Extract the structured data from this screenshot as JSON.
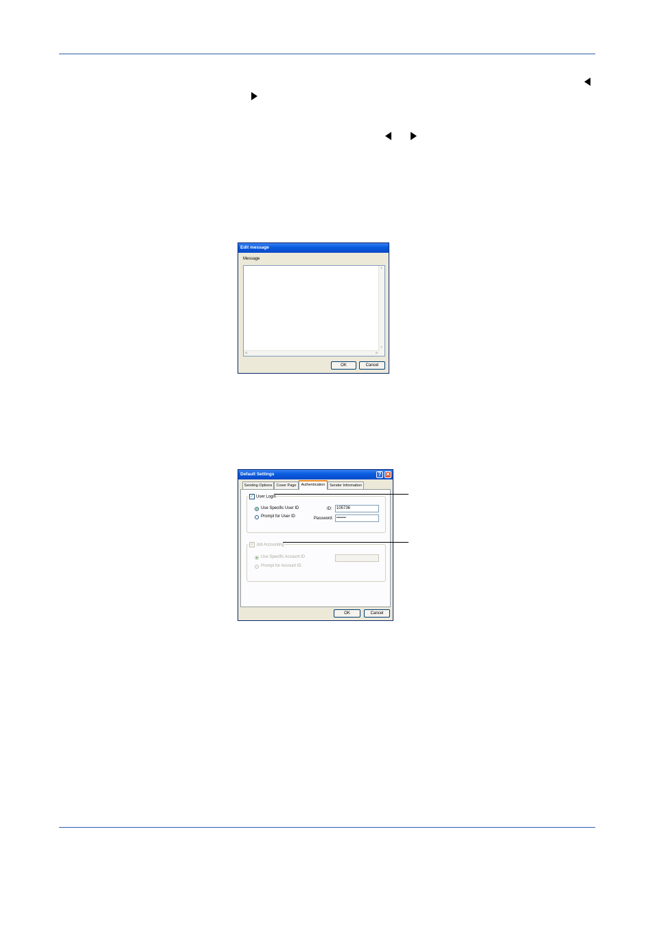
{
  "edit_message_dialog": {
    "title": "Edit message",
    "message_label": "Message",
    "ok_label": "OK",
    "cancel_label": "Cancel"
  },
  "default_settings_dialog": {
    "title": "Default Settings",
    "help_glyph": "?",
    "close_glyph": "✕",
    "tabs": [
      "Sending Options",
      "Cover Page",
      "Authentication",
      "Sender Information"
    ],
    "active_tab": "Authentication",
    "user_login": {
      "label": "User Login",
      "checked": true,
      "use_specific_label": "Use Specific User ID",
      "prompt_label": "Prompt for User ID",
      "id_label": "ID:",
      "id_value": "105736",
      "password_label": "Password:",
      "password_value": "••••••••"
    },
    "job_accounting": {
      "label": "Job Accounting",
      "checked": true,
      "enabled": false,
      "use_specific_label": "Use Specific Account ID",
      "prompt_label": "Prompt for Account ID"
    },
    "ok_label": "OK",
    "cancel_label": "Cancel"
  },
  "colors": {
    "rule": "#2a5db0",
    "xp_title": "#0a5ee0",
    "dialog_bg": "#ece9d8"
  },
  "icons": [
    "left-triangle-icon",
    "right-triangle-icon"
  ]
}
